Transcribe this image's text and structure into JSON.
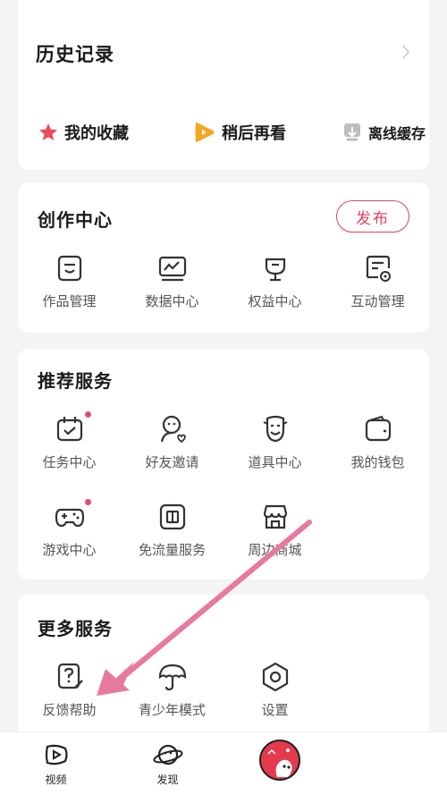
{
  "history": {
    "title": "历史记录"
  },
  "quick_links": [
    {
      "label": "我的收藏",
      "icon": "star-icon"
    },
    {
      "label": "稍后再看",
      "icon": "play-later-icon"
    },
    {
      "label": "离线缓存",
      "icon": "download-icon"
    }
  ],
  "creation": {
    "title": "创作中心",
    "publish_label": "发布",
    "items": [
      {
        "label": "作品管理",
        "icon": "works-icon"
      },
      {
        "label": "数据中心",
        "icon": "data-icon"
      },
      {
        "label": "权益中心",
        "icon": "benefits-icon"
      },
      {
        "label": "互动管理",
        "icon": "interaction-icon"
      }
    ]
  },
  "recommended": {
    "title": "推荐服务",
    "items": [
      {
        "label": "任务中心",
        "icon": "calendar-icon",
        "dot": true
      },
      {
        "label": "好友邀请",
        "icon": "invite-icon",
        "dot": false
      },
      {
        "label": "道具中心",
        "icon": "mask-icon",
        "dot": false
      },
      {
        "label": "我的钱包",
        "icon": "wallet-icon",
        "dot": false
      },
      {
        "label": "游戏中心",
        "icon": "gamepad-icon",
        "dot": true
      },
      {
        "label": "免流量服务",
        "icon": "sim-icon",
        "dot": false
      },
      {
        "label": "周边商城",
        "icon": "shop-icon",
        "dot": false
      }
    ]
  },
  "more": {
    "title": "更多服务",
    "items": [
      {
        "label": "反馈帮助",
        "icon": "feedback-icon"
      },
      {
        "label": "青少年模式",
        "icon": "umbrella-icon"
      },
      {
        "label": "设置",
        "icon": "settings-icon"
      }
    ]
  },
  "tabbar": [
    {
      "label": "视频",
      "icon": "video-icon"
    },
    {
      "label": "发现",
      "icon": "planet-icon"
    },
    {
      "label": "",
      "icon": "avatar"
    }
  ],
  "colors": {
    "accent": "#e04060",
    "star": "#e84a5f",
    "play": "#f5a623"
  }
}
